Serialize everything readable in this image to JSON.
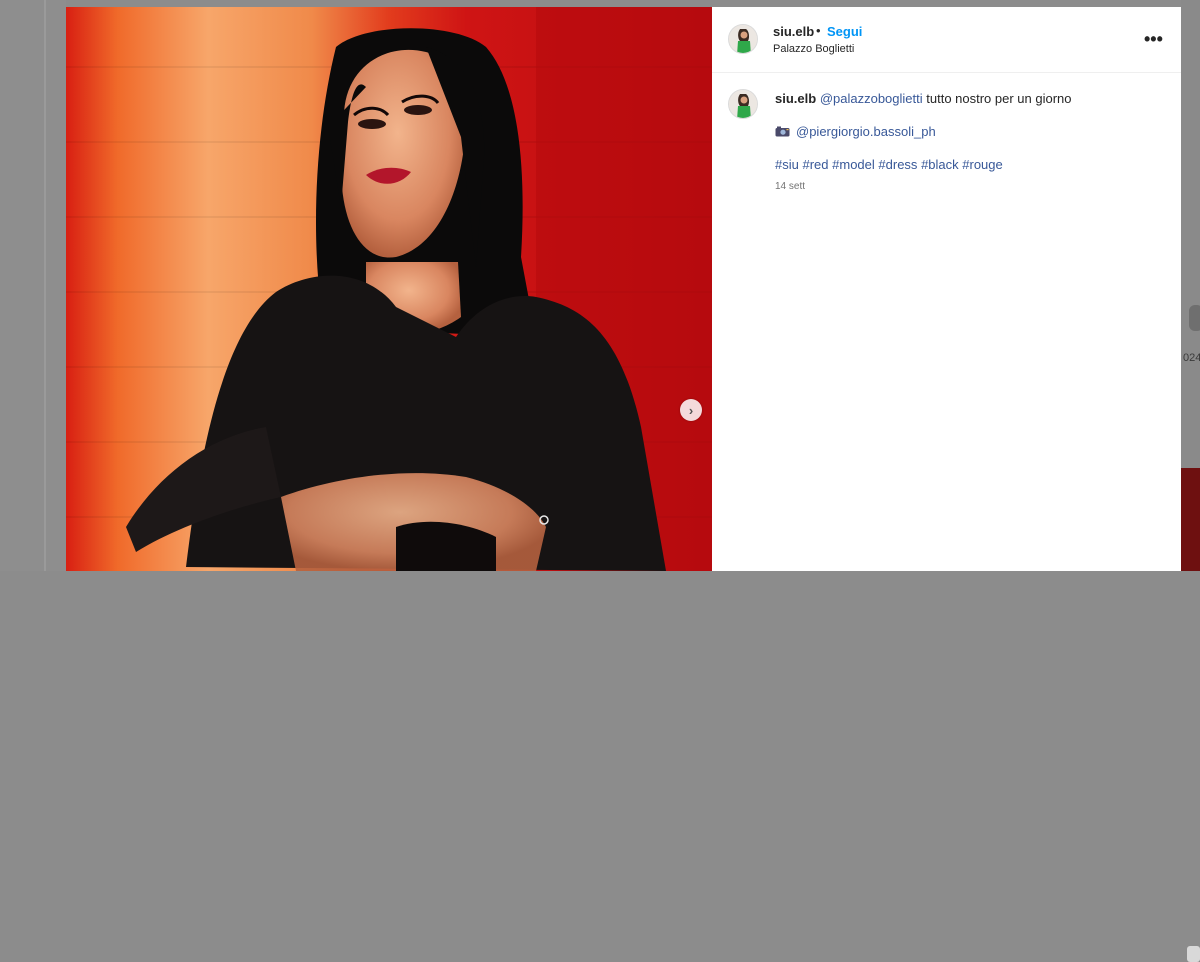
{
  "post": {
    "username": "siu.elb",
    "separator": "•",
    "follow_label": "Segui",
    "location": "Palazzo Boglietti",
    "more_icon": "•••"
  },
  "caption": {
    "username": "siu.elb",
    "mention": "@palazzoboglietti",
    "text": " tutto nostro per un giorno",
    "credit_icon": "camera-emoji",
    "credit_mention": "@piergiorgio.bassoli_ph",
    "hashtags": [
      "#siu",
      "#red",
      "#model",
      "#dress",
      "#black",
      "#rouge"
    ],
    "timestamp": "14 sett"
  },
  "media": {
    "next_icon": "›"
  },
  "background": {
    "partial_number": "024"
  },
  "colors": {
    "follow": "#0095f6",
    "link": "#385898",
    "text": "#262626",
    "muted": "#737373"
  }
}
